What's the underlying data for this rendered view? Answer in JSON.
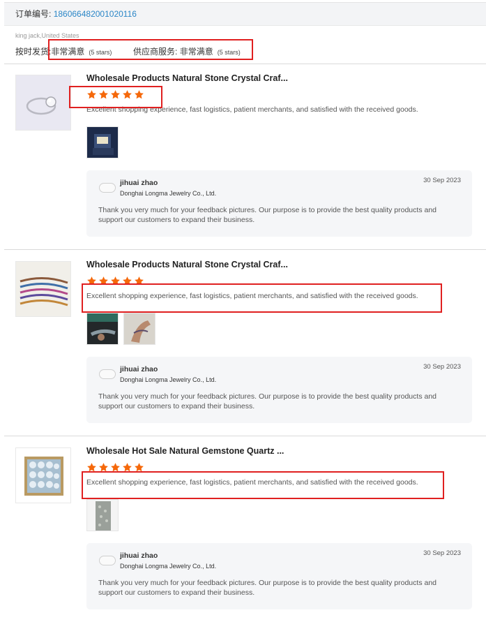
{
  "order": {
    "label": "订单编号:",
    "number": "186066482001020116"
  },
  "buyer": {
    "info": "king jack,United States"
  },
  "ratings": {
    "delivery_label": "按时发货:",
    "delivery_value": "非常满意",
    "delivery_stars": "(5 stars)",
    "service_label": "供应商服务:",
    "service_value": "非常满意",
    "service_stars": "(5 stars)"
  },
  "colors": {
    "star": "#f5680a",
    "link": "#2b86c7",
    "highlight": "#e02020"
  },
  "reviews": [
    {
      "title": "Wholesale Products Natural Stone Crystal Craf...",
      "stars": 5,
      "text": "Excellent shopping experience, fast logistics, patient merchants, and satisfied with the received goods.",
      "photo_count": 1,
      "reply": {
        "name": "jihuai zhao",
        "company": "Donghai Longma Jewelry Co., Ltd.",
        "date": "30 Sep 2023",
        "text": "Thank you very much for your feedback pictures. Our purpose is to provide the best quality products and support our customers to expand their business."
      }
    },
    {
      "title": "Wholesale Products Natural Stone Crystal Craf...",
      "stars": 5,
      "text": "Excellent shopping experience, fast logistics, patient merchants, and satisfied with the received goods.",
      "photo_count": 2,
      "reply": {
        "name": "jihuai zhao",
        "company": "Donghai Longma Jewelry Co., Ltd.",
        "date": "30 Sep 2023",
        "text": "Thank you very much for your feedback pictures. Our purpose is to provide the best quality products and support our customers to expand their business."
      }
    },
    {
      "title": "Wholesale Hot Sale Natural Gemstone Quartz ...",
      "stars": 5,
      "text": "Excellent shopping experience, fast logistics, patient merchants, and satisfied with the received goods.",
      "photo_count": 1,
      "reply": {
        "name": "jihuai zhao",
        "company": "Donghai Longma Jewelry Co., Ltd.",
        "date": "30 Sep 2023",
        "text": "Thank you very much for your feedback pictures. Our purpose is to provide the best quality products and support our customers to expand their business."
      }
    }
  ]
}
